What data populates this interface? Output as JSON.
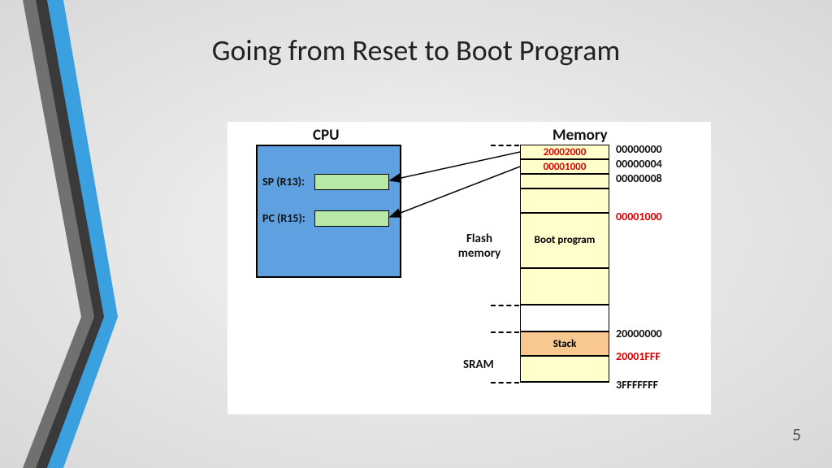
{
  "title": "Going from Reset to Boot Program",
  "pageNumber": "5",
  "cpu": {
    "header": "CPU",
    "sp_label": "SP (R13):",
    "pc_label": "PC (R15):"
  },
  "memory": {
    "header": "Memory",
    "flash_label": "Flash memory",
    "sram_label": "SRAM",
    "cells": {
      "c0": "20002000",
      "c1": "00001000",
      "boot": "Boot program",
      "stack": "Stack"
    },
    "addresses": {
      "a0": "00000000",
      "a1": "00000004",
      "a2": "00000008",
      "a3": "00001000",
      "a4": "20000000",
      "a5": "20001FFF",
      "a6": "3FFFFFFF"
    }
  }
}
